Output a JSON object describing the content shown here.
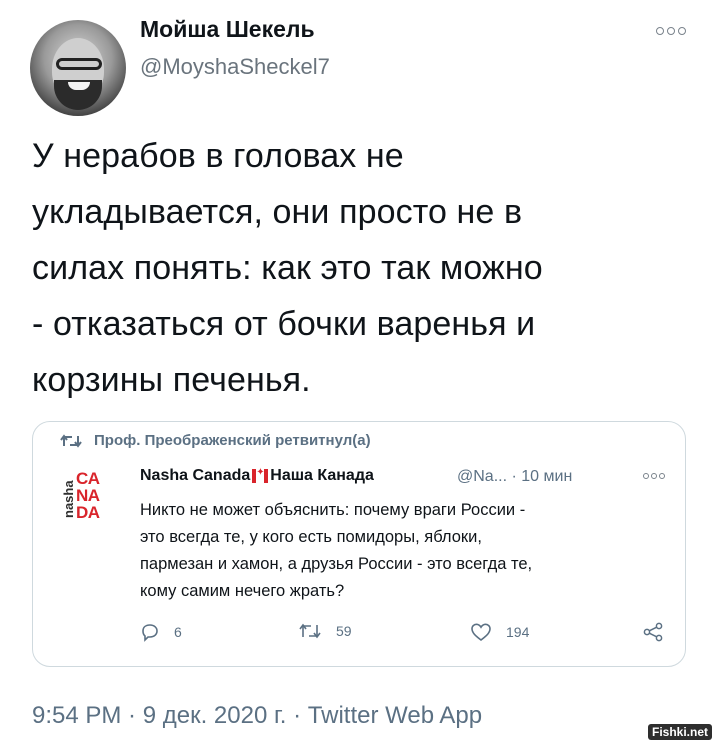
{
  "author": {
    "display_name": "Мойша Шекель",
    "handle": "@MoyshaSheckel7",
    "avatar_icon": "profile-photo"
  },
  "tweet": {
    "lines": [
      "У нерабов в головах не",
      "укладывается, они просто не в",
      "силах понять: как это так можно",
      "- отказаться от бочки варенья и",
      "корзины печенья."
    ]
  },
  "quoted": {
    "retweet_label": "Проф. Преображенский ретвитнул(а)",
    "logo_vertical": "nasha",
    "logo_lines": [
      "CA",
      "NA",
      "DA"
    ],
    "name_part1": "Nasha Canada",
    "name_part2": "Наша Канада",
    "handle": "@Na...",
    "separator": "·",
    "time": "10 мин",
    "text_lines": [
      "Никто не может объяснить: почему враги России -",
      "это всегда те, у кого есть помидоры, яблоки,",
      "пармезан и хамон, а друзья России - это всегда те,",
      "кому самим нечего жрать?"
    ],
    "reply_count": "6",
    "retweet_count": "59",
    "like_count": "194"
  },
  "footer": {
    "meta": "9:54 PM · 9 дек. 2020 г. · Twitter Web App"
  },
  "watermark": "Fishki.net",
  "colors": {
    "text": "#0f1419",
    "secondary": "#5b7083",
    "border": "#cfd9de",
    "brand_red": "#d9242b"
  }
}
